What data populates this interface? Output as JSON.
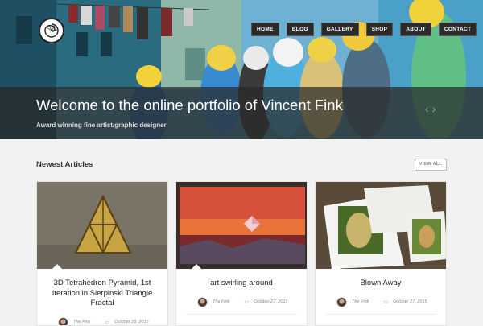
{
  "site": {
    "nav": [
      "HOME",
      "BLOG",
      "GALLERY",
      "SHOP",
      "ABOUT",
      "CONTACT"
    ]
  },
  "hero": {
    "title": "Welcome to the online portfolio of Vincent Fink",
    "subtitle": "Award winning fine artist/graphic designer",
    "prev": "‹",
    "next": "›"
  },
  "section": {
    "title": "Newest Articles",
    "view_all": "VIEW ALL"
  },
  "articles": [
    {
      "title": "3D Tetrahedron Pyramid, 1st Iteration in Sierpinski Triangle Fractal",
      "author": "The Fink",
      "date": "October 28, 2015"
    },
    {
      "title": "art swirling around",
      "author": "The Fink",
      "date": "October 27, 2015"
    },
    {
      "title": "Blown Away",
      "author": "The Fink",
      "date": "October 27, 2015"
    }
  ]
}
